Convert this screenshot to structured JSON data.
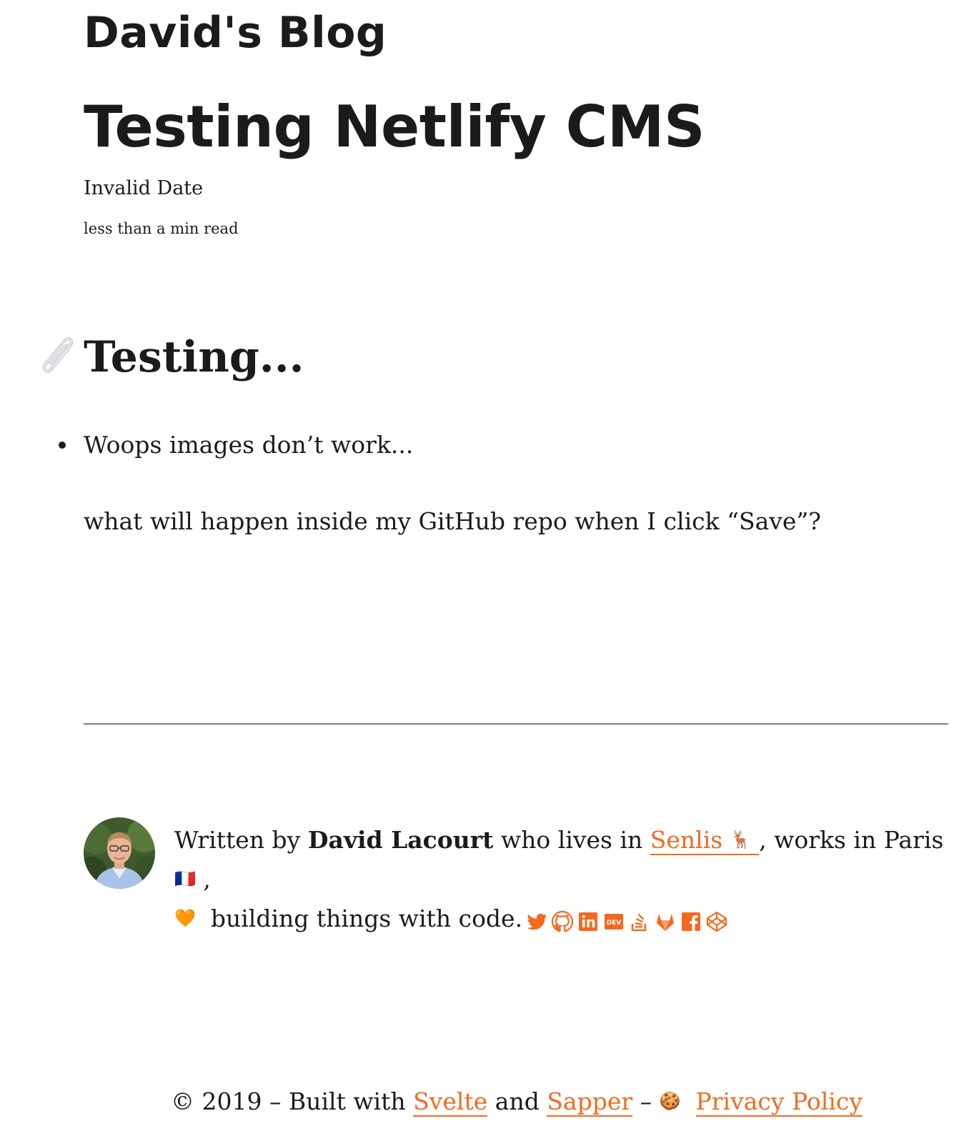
{
  "site": {
    "title": "David's Blog"
  },
  "post": {
    "title": "Testing Netlify CMS",
    "date": "Invalid Date",
    "read_time": "less than a min read",
    "section_heading": "Testing...",
    "bullets": [
      "Woops images don’t work..."
    ],
    "paragraph": "what will happen inside my GitHub repo when I click “Save”?"
  },
  "author": {
    "written_by": "Written by",
    "name": "David Lacourt",
    "lives_in": "who lives in",
    "city_link": "Senlis",
    "city_emoji": "🦌",
    "works_in": ", works in Paris",
    "flag_emoji": "🇫🇷",
    "comma": ",",
    "heart_emoji": "🧡",
    "building": "building things with code.",
    "social_icons": [
      "twitter-icon",
      "github-icon",
      "linkedin-icon",
      "dev-icon",
      "stackoverflow-icon",
      "gitlab-icon",
      "facebook-icon",
      "codepen-icon"
    ]
  },
  "colors": {
    "accent": "#f26a20",
    "text": "#1b1b1b",
    "divider": "#8a8a8a"
  },
  "footer": {
    "copyright": "© 2019 – Built with",
    "svelte": "Svelte",
    "and": "and",
    "sapper": "Sapper",
    "dash": "–",
    "cookie_emoji": "🍪",
    "privacy": "Privacy Policy"
  }
}
